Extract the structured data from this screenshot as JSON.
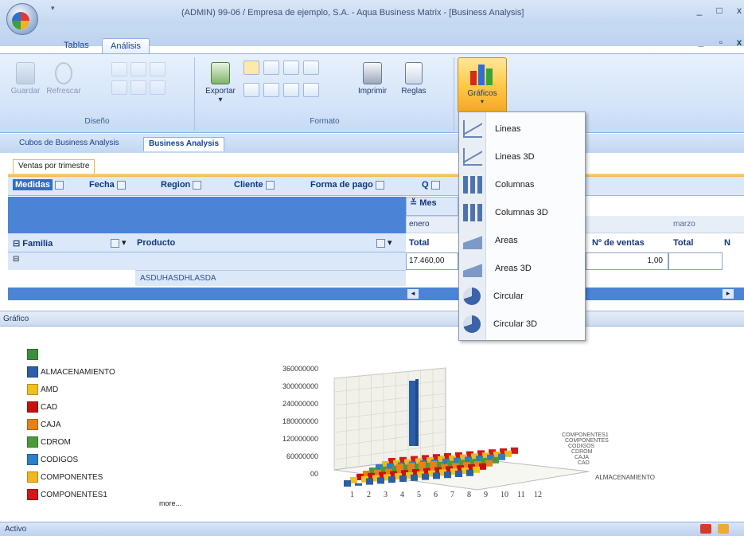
{
  "window": {
    "title": "(ADMIN) 99-06 / Empresa de ejemplo, S.A. - Aqua Business Matrix - [Business Analysis]",
    "controls": [
      "_",
      "□",
      "x"
    ],
    "mdi_controls": [
      "_",
      "▫",
      "x"
    ]
  },
  "ribbon": {
    "tabs": [
      "Tablas",
      "Análisis"
    ],
    "active_tab": "Análisis",
    "groups": {
      "diseno": {
        "label": "Diseño",
        "buttons": [
          "Guardar",
          "Refrescar"
        ]
      },
      "formato": {
        "label": "Formato",
        "buttons": [
          "Exportar",
          "Imprimir",
          "Reglas"
        ]
      },
      "graficos": {
        "label": "Gráficos"
      }
    }
  },
  "doc_tabs": [
    "Cubos de Business Analysis",
    "Business Analysis"
  ],
  "sub_tab": "Ventas por trimestre",
  "pivot": {
    "fields": [
      "Medidas",
      "Fecha",
      "Region",
      "Cliente",
      "Forma de pago",
      "Q"
    ],
    "column_field": "Mes",
    "months": [
      "enero",
      "marzo"
    ],
    "row_headers": [
      "Familia",
      "Producto"
    ],
    "measure_headers": [
      "Total",
      "Nº de ventas",
      "Total",
      "N"
    ],
    "cells": {
      "total": "17.460,00",
      "ventas": "1,00",
      "producto": "ASDUHASDHLASDA"
    }
  },
  "chart_menu": {
    "items": [
      {
        "label": "Lineas",
        "icon": "line-chart-icon"
      },
      {
        "label": "Lineas 3D",
        "icon": "line-3d-chart-icon"
      },
      {
        "label": "Columnas",
        "icon": "column-chart-icon"
      },
      {
        "label": "Columnas 3D",
        "icon": "column-3d-chart-icon"
      },
      {
        "label": "Areas",
        "icon": "area-chart-icon"
      },
      {
        "label": "Areas 3D",
        "icon": "area-3d-chart-icon"
      },
      {
        "label": "Circular",
        "icon": "pie-chart-icon"
      },
      {
        "label": "Circular 3D",
        "icon": "pie-3d-chart-icon"
      }
    ]
  },
  "grafico_panel": {
    "title": "Gráfico",
    "more": "more..."
  },
  "chart_data": {
    "type": "bar",
    "y_ticks": [
      "360000000",
      "300000000",
      "240000000",
      "180000000",
      "120000000",
      "60000000",
      "00"
    ],
    "categories": [
      "1",
      "2",
      "3",
      "4",
      "5",
      "6",
      "7",
      "8",
      "9",
      "10",
      "11",
      "12"
    ],
    "z_label": "ALMACENAMIENTO",
    "series": [
      {
        "name": "",
        "color": "#3a8f3a"
      },
      {
        "name": "ALMACENAMIENTO",
        "color": "#2a5fa8"
      },
      {
        "name": "AMD",
        "color": "#f0c020"
      },
      {
        "name": "CAD",
        "color": "#c81010"
      },
      {
        "name": "CAJA",
        "color": "#e8801a"
      },
      {
        "name": "CDROM",
        "color": "#4a9a3a"
      },
      {
        "name": "CODIGOS",
        "color": "#2a7fc8"
      },
      {
        "name": "COMPONENTES",
        "color": "#f0b820"
      },
      {
        "name": "COMPONENTES1",
        "color": "#d01818"
      }
    ]
  },
  "status": {
    "text": "Activo"
  }
}
